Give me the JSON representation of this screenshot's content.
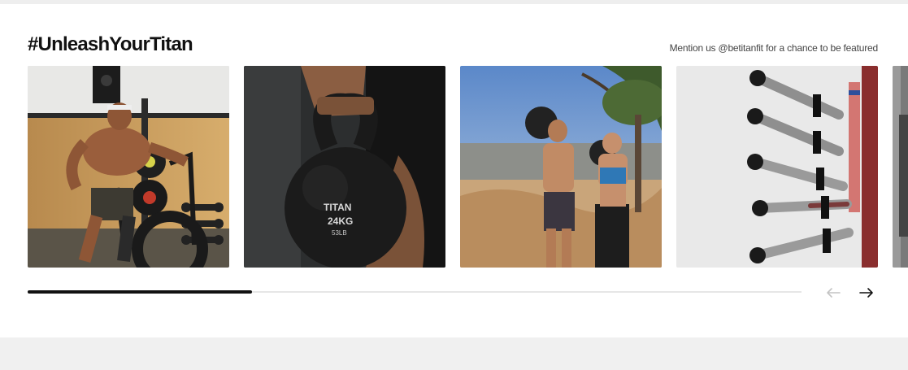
{
  "section": {
    "title": "#UnleashYourTitan",
    "mention_text": "Mention us @betitanfit for a chance to be featured"
  },
  "gallery": {
    "items": [
      {
        "icon": "athlete-air-bike-photo"
      },
      {
        "icon": "kettlebell-photo",
        "kettlebell_brand": "TITAN",
        "kettlebell_weight": "24KG",
        "kettlebell_weight_lb": "53LB"
      },
      {
        "icon": "couple-slam-balls-photo"
      },
      {
        "icon": "barbell-rack-photo"
      },
      {
        "icon": "partial-photo"
      }
    ]
  },
  "carousel": {
    "progress": 0.29,
    "prev_icon": "arrow-left-icon",
    "next_icon": "arrow-right-icon",
    "prev_disabled": true
  }
}
